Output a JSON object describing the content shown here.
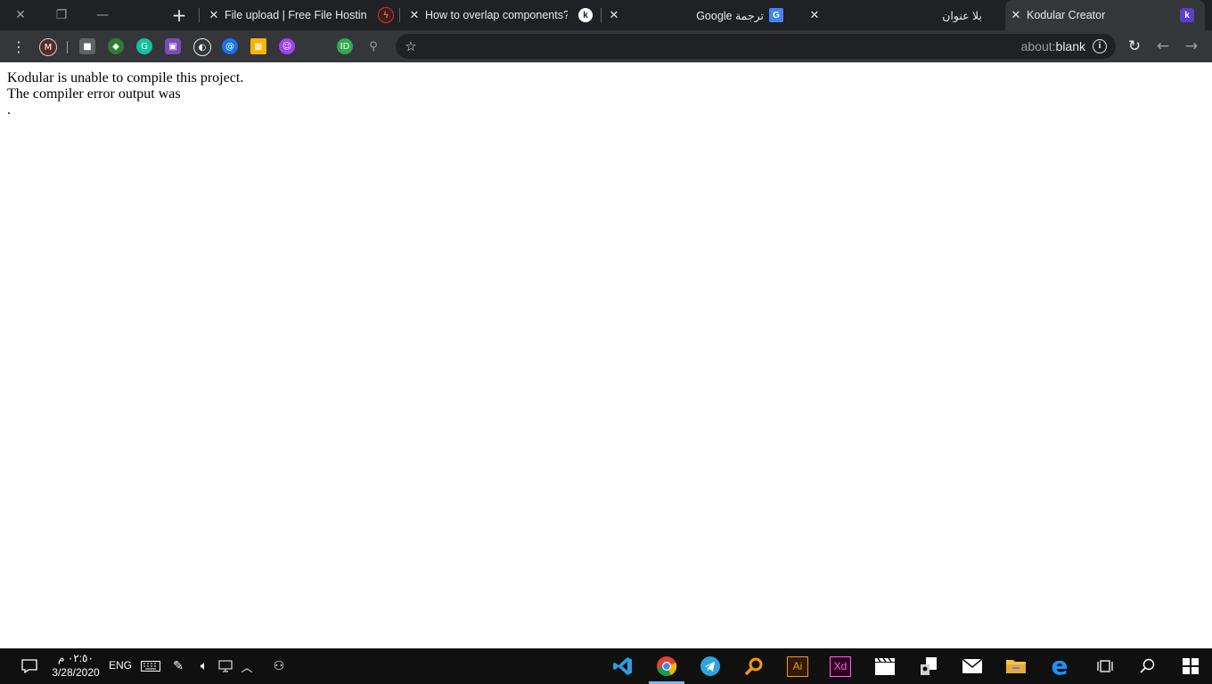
{
  "browser": {
    "tabs": [
      {
        "title": "File upload | Free File Hosting"
      },
      {
        "title": "How to overlap components?"
      },
      {
        "title": "Google ترجمة"
      },
      {
        "title": "بلا عنوان"
      },
      {
        "title": "Kodular Creator",
        "active": true
      }
    ],
    "omnibox": {
      "url_scheme": "about:",
      "url_host": "blank"
    },
    "extension_icons": [
      "avatar-icon",
      "cube-icon",
      "leaf-icon",
      "grammarly-icon",
      "box-icon",
      "mouse-icon",
      "at-icon",
      "grid-icon",
      "face-icon",
      "id-icon",
      "search-icon"
    ],
    "colors": {
      "tabstrip": "#202124",
      "toolbar": "#35363a",
      "kodular": "#5b3fc7"
    }
  },
  "page": {
    "line1": "Kodular is unable to compile this project.",
    "line2": "The compiler error output was",
    "line3": "."
  },
  "taskbar": {
    "clock_time": "٠٢:٥٠ م",
    "clock_date": "3/28/2020",
    "language": "ENG",
    "apps": [
      "vscode-icon",
      "chrome-icon",
      "telegram-icon",
      "search-app-icon",
      "illustrator-icon",
      "xd-icon",
      "clapper-icon",
      "printer-icon",
      "mail-icon",
      "folder-icon",
      "edge-icon",
      "taskview-icon",
      "search-icon",
      "windows-icon"
    ],
    "illustrator_label": "Ai",
    "xd_label": "Xd"
  }
}
